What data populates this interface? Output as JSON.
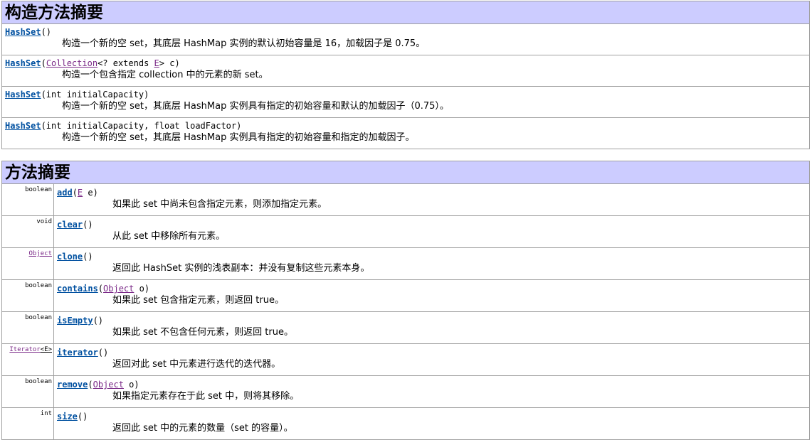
{
  "constructor_summary": {
    "title": "构造方法摘要",
    "rows": [
      {
        "name": "HashSet",
        "pre": "",
        "link": "",
        "mid": "",
        "link2": "",
        "post": "()",
        "desc": "构造一个新的空 set，其底层 HashMap 实例的默认初始容量是 16，加载因子是 0.75。"
      },
      {
        "name": "HashSet",
        "pre": "(",
        "link": "Collection",
        "mid": "<? extends ",
        "link2": "E",
        "post": "> c)",
        "desc": "构造一个包含指定 collection 中的元素的新 set。"
      },
      {
        "name": "HashSet",
        "pre": "(int initialCapacity)",
        "link": "",
        "mid": "",
        "link2": "",
        "post": "",
        "desc": "构造一个新的空 set，其底层 HashMap 实例具有指定的初始容量和默认的加载因子（0.75）。"
      },
      {
        "name": "HashSet",
        "pre": "(int initialCapacity, float loadFactor)",
        "link": "",
        "mid": "",
        "link2": "",
        "post": "",
        "desc": "构造一个新的空 set，其底层 HashMap 实例具有指定的初始容量和指定的加载因子。"
      }
    ]
  },
  "method_summary": {
    "title": "方法摘要",
    "rows": [
      {
        "type": "boolean",
        "type_link": "",
        "type_suffix": "",
        "name": "add",
        "pre": "(",
        "link": "E",
        "post": " e)",
        "desc": "如果此 set 中尚未包含指定元素，则添加指定元素。"
      },
      {
        "type": "void",
        "type_link": "",
        "type_suffix": "",
        "name": "clear",
        "pre": "()",
        "link": "",
        "post": "",
        "desc": "从此 set 中移除所有元素。"
      },
      {
        "type": "",
        "type_link": "Object",
        "type_suffix": "",
        "name": "clone",
        "pre": "()",
        "link": "",
        "post": "",
        "desc": "返回此 HashSet 实例的浅表副本：并没有复制这些元素本身。"
      },
      {
        "type": "boolean",
        "type_link": "",
        "type_suffix": "",
        "name": "contains",
        "pre": "(",
        "link": "Object",
        "post": " o)",
        "desc": "如果此 set 包含指定元素，则返回 true。"
      },
      {
        "type": "boolean",
        "type_link": "",
        "type_suffix": "",
        "name": "isEmpty",
        "pre": "()",
        "link": "",
        "post": "",
        "desc": "如果此 set 不包含任何元素，则返回 true。"
      },
      {
        "type": "",
        "type_link": "Iterator",
        "type_suffix": "<E>",
        "name": "iterator",
        "pre": "()",
        "link": "",
        "post": "",
        "desc": "返回对此 set 中元素进行迭代的迭代器。"
      },
      {
        "type": "boolean",
        "type_link": "",
        "type_suffix": "",
        "name": "remove",
        "pre": "(",
        "link": "Object",
        "post": " o)",
        "desc": "如果指定元素存在于此 set 中，则将其移除。"
      },
      {
        "type": "int",
        "type_link": "",
        "type_suffix": "",
        "name": "size",
        "pre": "()",
        "link": "",
        "post": "",
        "desc": "返回此 set 中的元素的数量（set 的容量）。"
      }
    ]
  },
  "colors": {
    "header_bg": "#ccccff",
    "link": "#0050a0",
    "type_link": "#7b2a88",
    "border": "#a0a0a0"
  }
}
